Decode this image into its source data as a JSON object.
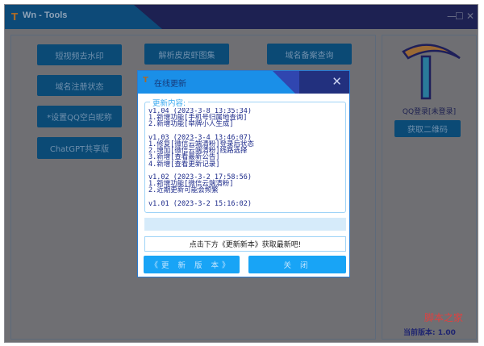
{
  "window": {
    "title": "Wn - Tools",
    "controls": [
      "—",
      "☐",
      "✕"
    ]
  },
  "tools": [
    "短视频去水印",
    "解析皮皮虾图集",
    "域名备案查询",
    "域名注册状态",
    "*设置QQ空白昵称",
    "ChatGPT共享版"
  ],
  "sidebar": {
    "qq_status": "QQ登录[未登录]",
    "qr_button": "获取二维码",
    "version": "当前版本: 1.00"
  },
  "dialog": {
    "title": "在线更新",
    "close": "✕",
    "group_label": "更新内容:",
    "log": "v1.04 (2023-3-8 13:35:34)\n1.新增功能[手机号归属地查询]\n2.新增功能[举牌小人生成]\n\nv1.03 (2023-3-4 13:46:07)\n1.修复[微信云端清粉]登录后状态\n2.增加[微信云端清粉]线路选择\n3.新增[查看最新公告]\n4.新增[查看更新记录]\n\nv1.02 (2023-3-2 17:58:56)\n1.新增功能[微信云端清粉]\n2.近期更新可能会频繁\n\nv1.01 (2023-3-2 15:16:02)",
    "progress": 0,
    "message": "点击下方《更新新本》获取最新吧!",
    "update_button": "《更 新 版 本》",
    "close_button": "关 闭"
  },
  "watermark": "脚本之家"
}
